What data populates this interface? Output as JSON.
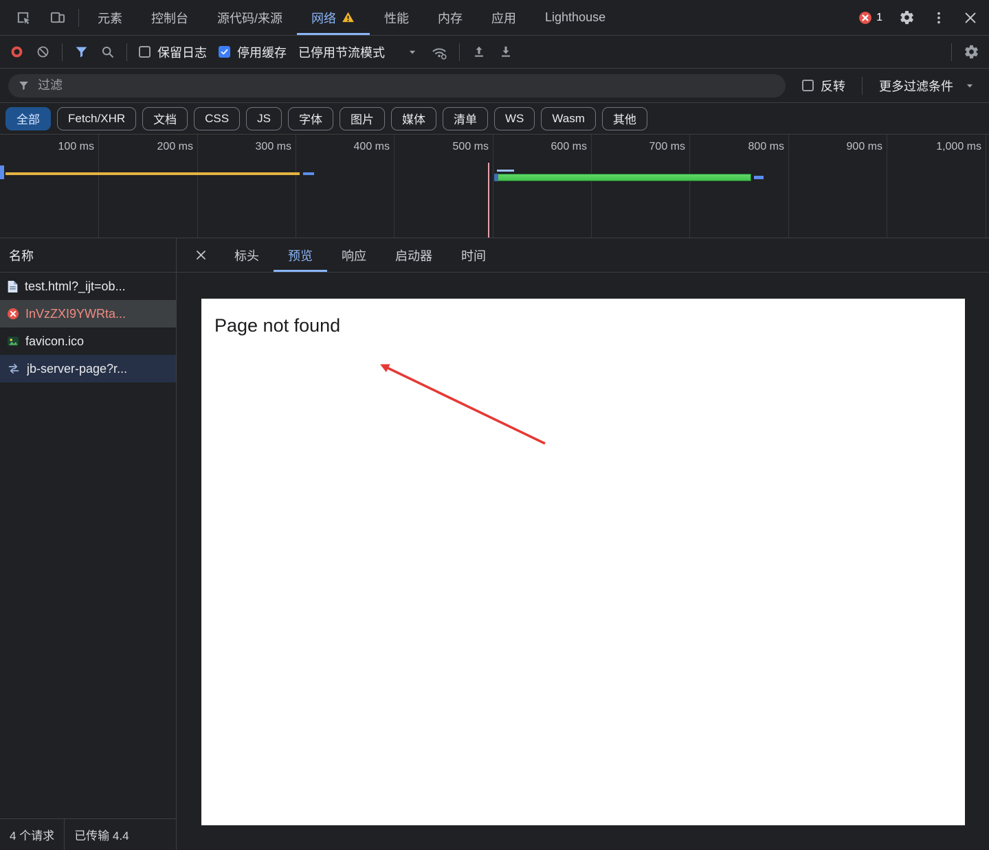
{
  "colors": {
    "bg": "#202124",
    "surface": "#292a2d",
    "border": "#3c4043",
    "text": "#e8eaed",
    "text-dim": "#9aa0a6",
    "accent": "#8ab4f8",
    "chip-sel-bg": "#1f538f",
    "chip-sel-text": "#d8e7ff",
    "warn": "#f0b429",
    "error": "#e5534b",
    "record": "#e0504a",
    "check-blue": "#3d7ef7",
    "bar-yellow": "#e3b341",
    "bar-green": "#3fc24a",
    "bar-blue": "#5c8ded",
    "marker-pink": "#e6a3ac",
    "row-selected": "#3c4043",
    "row-stripe": "#263147",
    "arrow": "#e53935"
  },
  "tabbar": {
    "tabs": [
      "元素",
      "控制台",
      "源代码/来源",
      "网络",
      "性能",
      "内存",
      "应用",
      "Lighthouse"
    ],
    "active_tab": "网络",
    "error_count": "1"
  },
  "toolbar": {
    "preserve_log": "保留日志",
    "disable_cache": "停用缓存",
    "throttling": "已停用节流模式"
  },
  "filterbar": {
    "placeholder": "过滤",
    "invert_label": "反转",
    "more_filters_label": "更多过滤条件"
  },
  "chips": {
    "items": [
      "全部",
      "Fetch/XHR",
      "文档",
      "CSS",
      "JS",
      "字体",
      "图片",
      "媒体",
      "清单",
      "WS",
      "Wasm",
      "其他"
    ],
    "selected": "全部"
  },
  "overview": {
    "ticks": [
      "100 ms",
      "200 ms",
      "300 ms",
      "400 ms",
      "500 ms",
      "600 ms",
      "700 ms",
      "800 ms",
      "900 ms",
      "1,000 ms"
    ]
  },
  "requests": {
    "header": "名称",
    "rows": [
      {
        "name": "test.html?_ijt=ob...",
        "icon": "document-icon"
      },
      {
        "name": "InVzZXI9YWRta...",
        "icon": "error-icon",
        "state": "selected"
      },
      {
        "name": "favicon.ico",
        "icon": "image-icon"
      },
      {
        "name": "jb-server-page?r...",
        "icon": "exchange-icon"
      }
    ],
    "footer": {
      "count": "4 个请求",
      "transferred": "已传输 4.4"
    }
  },
  "detail": {
    "tabs": [
      "标头",
      "预览",
      "响应",
      "启动器",
      "时间"
    ],
    "active_tab": "预览",
    "preview_text": "Page not found"
  },
  "icons": {
    "inspect-icon": "cursor-in-box",
    "device-toolbar-icon": "phone-tablet",
    "warning-icon": "yellow-triangle-!",
    "error-icon": "red-circle-x",
    "gear-icon": "settings-gear",
    "kebab-menu-icon": "vertical-dots",
    "close-icon": "x",
    "record-icon": "red-ring",
    "clear-icon": "circle-slash",
    "filter-icon": "funnel",
    "search-icon": "magnifier",
    "network-conditions-icon": "wifi-gear",
    "import-har-icon": "arrow-up-tray",
    "export-har-icon": "arrow-down-tray",
    "document-icon": "file-page",
    "image-icon": "picture",
    "exchange-icon": "double-arrows"
  }
}
